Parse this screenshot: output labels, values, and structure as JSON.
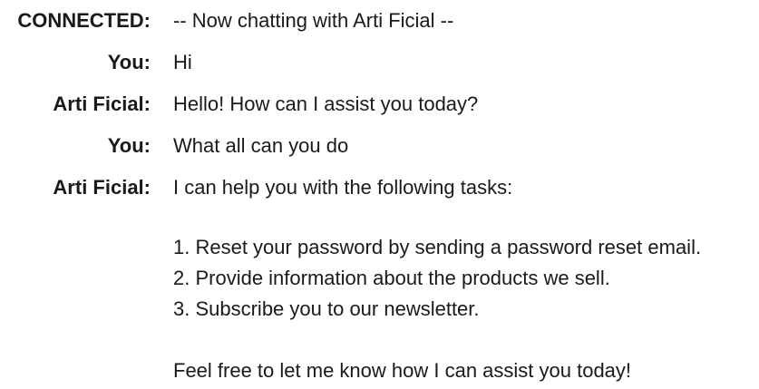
{
  "chat": {
    "messages": [
      {
        "speaker": "CONNECTED:",
        "text": "-- Now chatting with Arti Ficial --"
      },
      {
        "speaker": "You:",
        "text": "Hi"
      },
      {
        "speaker": "Arti Ficial:",
        "text": "Hello! How can I assist you today?"
      },
      {
        "speaker": "You:",
        "text": "What all can you do"
      },
      {
        "speaker": "Arti Ficial:",
        "intro": "I can help you with the following tasks:",
        "list": [
          "1. Reset your password by sending a password reset email.",
          "2. Provide information about the products we sell.",
          "3. Subscribe you to our newsletter."
        ],
        "closing": "Feel free to let me know how I can assist you today!"
      }
    ]
  }
}
